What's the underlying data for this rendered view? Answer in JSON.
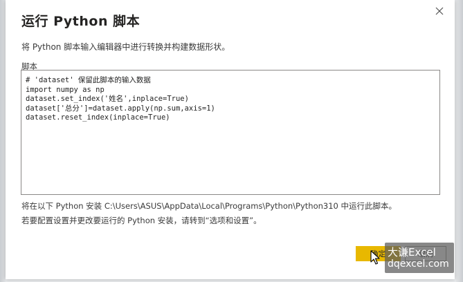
{
  "dialog": {
    "title": "运行 Python 脚本",
    "description": "将 Python 脚本输入编辑器中进行转换并构建数据形状。",
    "script_label": "脚本",
    "script_lines": [
      "# 'dataset' 保留此脚本的输入数据",
      "import numpy as np",
      "dataset.set_index('姓名',inplace=True)",
      "dataset['总分']=dataset.apply(np.sum,axis=1)",
      "dataset.reset_index(inplace=True)"
    ],
    "info_line_1": "将在以下 Python 安装 C:\\Users\\ASUS\\AppData\\Local\\Programs\\Python\\Python310 中运行此脚本。",
    "info_line_2": "若要配置设置并更改要运行的 Python 安装，请转到“选项和设置”。",
    "close_icon": "close-icon",
    "buttons": {
      "ok": "确定",
      "cancel": "取消"
    }
  },
  "watermark": {
    "line1": "大谦Excel",
    "line2": "dqexcel.com"
  },
  "colors": {
    "primary_button": "#e8b800",
    "dialog_bg": "#ffffff",
    "text": "#252423"
  }
}
